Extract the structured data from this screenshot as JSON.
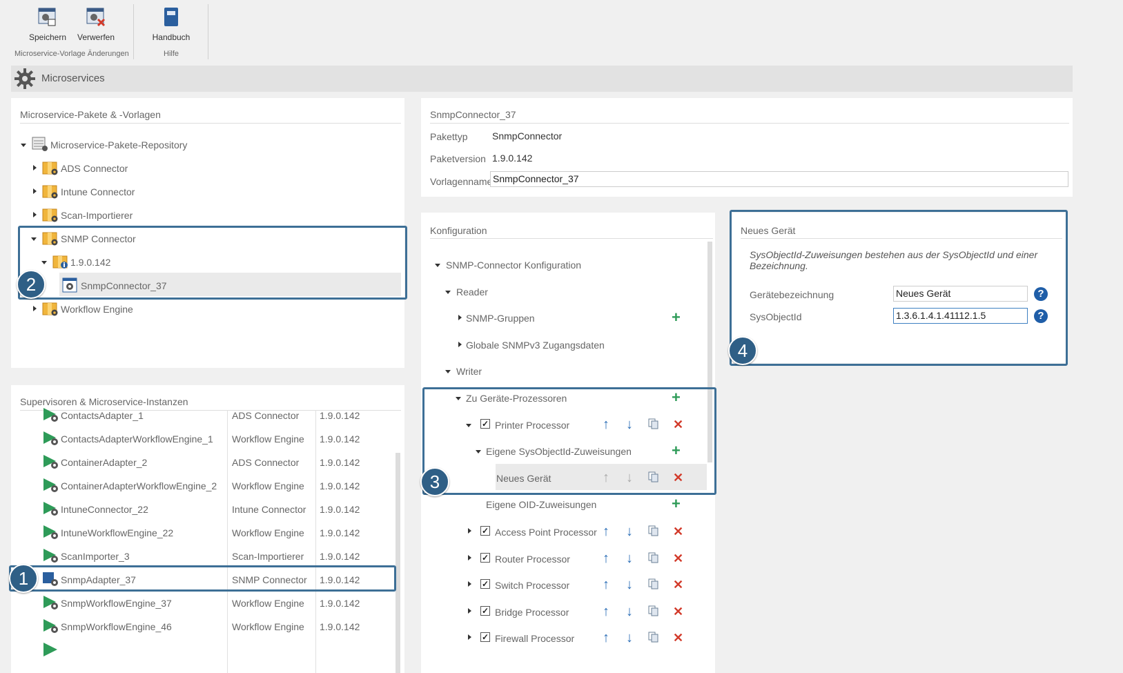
{
  "ribbon": {
    "save_label": "Speichern",
    "discard_label": "Verwerfen",
    "manual_label": "Handbuch",
    "group_changes": "Microservice-Vorlage Änderungen",
    "group_help": "Hilfe"
  },
  "header": {
    "title": "Microservices"
  },
  "packages": {
    "title": "Microservice-Pakete & -Vorlagen",
    "root": "Microservice-Pakete-Repository",
    "items": [
      "ADS Connector",
      "Intune Connector",
      "Scan-Importierer",
      "SNMP Connector"
    ],
    "snmp_version": "1.9.0.142",
    "snmp_template": "SnmpConnector_37",
    "workflow": "Workflow Engine"
  },
  "instances": {
    "title": "Supervisoren & Microservice-Instanzen",
    "rows": [
      {
        "name": "ContactsAdapter_1",
        "type": "ADS Connector",
        "version": "1.9.0.142"
      },
      {
        "name": "ContactsAdapterWorkflowEngine_1",
        "type": "Workflow Engine",
        "version": "1.9.0.142"
      },
      {
        "name": "ContainerAdapter_2",
        "type": "ADS Connector",
        "version": "1.9.0.142"
      },
      {
        "name": "ContainerAdapterWorkflowEngine_2",
        "type": "Workflow Engine",
        "version": "1.9.0.142"
      },
      {
        "name": "IntuneConnector_22",
        "type": "Intune Connector",
        "version": "1.9.0.142"
      },
      {
        "name": "IntuneWorkflowEngine_22",
        "type": "Workflow Engine",
        "version": "1.9.0.142"
      },
      {
        "name": "ScanImporter_3",
        "type": "Scan-Importierer",
        "version": "1.9.0.142"
      },
      {
        "name": "SnmpAdapter_37",
        "type": "SNMP Connector",
        "version": "1.9.0.142"
      },
      {
        "name": "SnmpWorkflowEngine_37",
        "type": "Workflow Engine",
        "version": "1.9.0.142"
      },
      {
        "name": "SnmpWorkflowEngine_46",
        "type": "Workflow Engine",
        "version": "1.9.0.142"
      }
    ]
  },
  "details": {
    "title": "SnmpConnector_37",
    "type_label": "Pakettyp",
    "type_value": "SnmpConnector",
    "version_label": "Paketversion",
    "version_value": "1.9.0.142",
    "name_label": "Vorlagenname",
    "name_value": "SnmpConnector_37"
  },
  "config": {
    "title": "Konfiguration",
    "root": "SNMP-Connector Konfiguration",
    "reader": "Reader",
    "snmp_groups": "SNMP-Gruppen",
    "global_v3": "Globale SNMPv3 Zugangsdaten",
    "writer": "Writer",
    "to_processors": "Zu Geräte-Prozessoren",
    "printer": "Printer Processor",
    "own_sysobj": "Eigene SysObjectId-Zuweisungen",
    "new_device": "Neues Gerät",
    "own_oid": "Eigene OID-Zuweisungen",
    "access_point": "Access Point Processor",
    "router": "Router Processor",
    "switch": "Switch Processor",
    "bridge": "Bridge Processor",
    "firewall": "Firewall Processor"
  },
  "new_device_panel": {
    "title": "Neues Gerät",
    "description": "SysObjectId-Zuweisungen bestehen aus der SysObjectId und einer Bezeichnung.",
    "name_label": "Gerätebezeichnung",
    "name_value": "Neues Gerät",
    "sysobj_label": "SysObjectId",
    "sysobj_value": "1.3.6.1.4.1.41112.1.5"
  },
  "callouts": [
    "1",
    "2",
    "3",
    "4"
  ],
  "colors": {
    "accent": "#3d6f96",
    "add": "#2e9b58",
    "move": "#2d6fb7",
    "delete": "#d23a2a"
  }
}
